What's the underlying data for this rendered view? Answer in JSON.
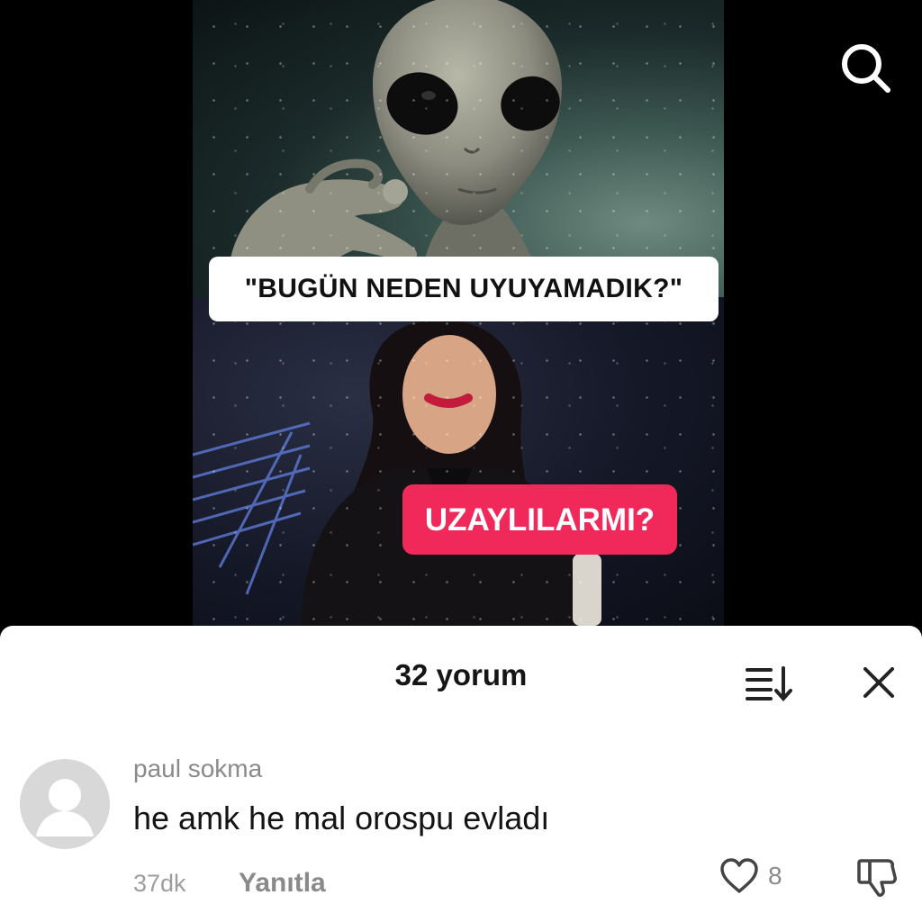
{
  "video": {
    "caption_top": "\"BUGÜN NEDEN UYUYAMADIK?\"",
    "caption_bottom": "UZAYLILARMI?",
    "caption_bottom_color": "#f1295a",
    "search_icon": "search-icon"
  },
  "comments_sheet": {
    "title": "32 yorum",
    "sort_icon": "sort-icon",
    "close_icon": "close-icon",
    "comments": [
      {
        "username": "paul sokma",
        "text": "he amk he mal orospu evladı",
        "time": "37dk",
        "reply_label": "Yanıtla",
        "like_count": "8",
        "like_icon": "heart-icon",
        "dislike_icon": "thumbs-down-icon"
      }
    ]
  }
}
